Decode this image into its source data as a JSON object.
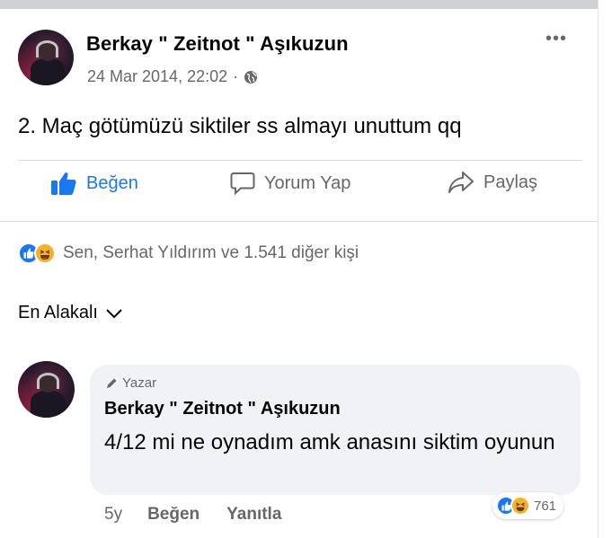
{
  "post": {
    "author": "Berkay \" Zeitnot \" Aşıkuzun",
    "timestamp": "24 Mar 2014, 22:02",
    "separator": "·",
    "text": "2. Maç götümüzü siktiler ss almayı unuttum qq",
    "more_label": "•••"
  },
  "actions": {
    "like_label": "Beğen",
    "comment_label": "Yorum Yap",
    "share_label": "Paylaş"
  },
  "reactions": {
    "summary": "Sen, Serhat Yıldırım ve 1.541 diğer kişi",
    "icons": [
      "like-icon",
      "haha-icon"
    ]
  },
  "sort": {
    "label": "En Alakalı"
  },
  "comment": {
    "badge": "Yazar",
    "author": "Berkay \" Zeitnot \" Aşıkuzun",
    "text": "4/12 mi ne oynadım amk anasını siktim oyunun",
    "reaction_count": "761",
    "age": "5y",
    "like_label": "Beğen",
    "reply_label": "Yanıtla"
  },
  "colors": {
    "accent": "#1877f2",
    "haha": "#f7b125",
    "secondary_text": "#65676b",
    "bubble": "#f0f2f5"
  }
}
